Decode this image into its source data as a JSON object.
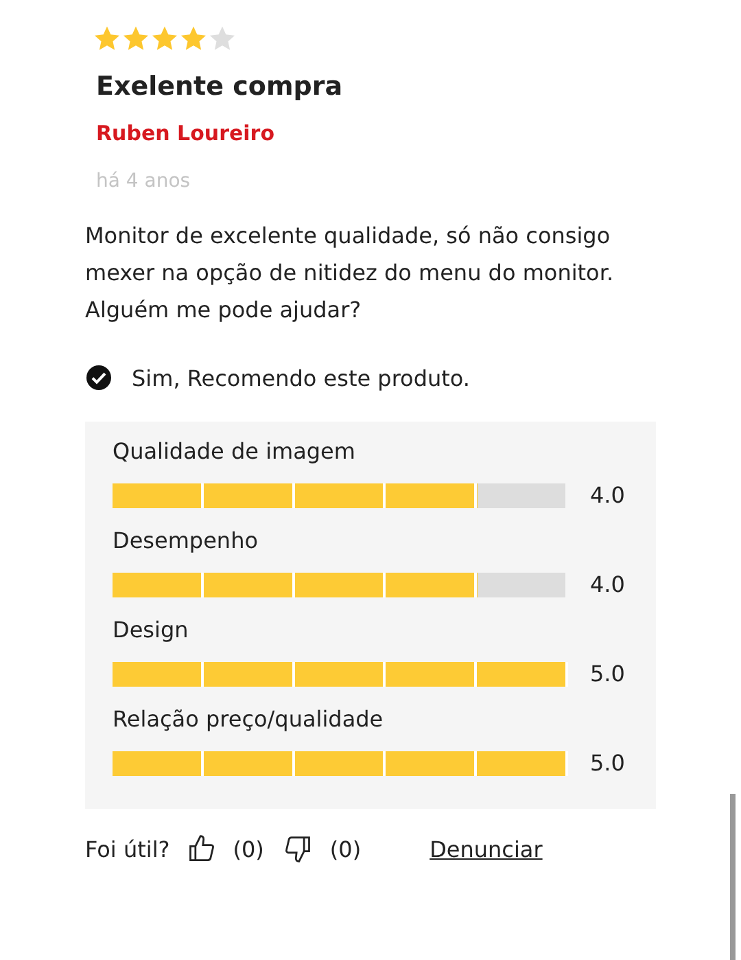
{
  "review": {
    "stars": 4,
    "title": "Exelente compra",
    "author": "Ruben Loureiro",
    "date": "há 4 anos",
    "body": "Monitor de excelente qualidade, só não consigo mexer na opção de nitidez do menu do monitor. Alguém me pode ajudar?",
    "recommend": {
      "checked": true,
      "label": "Sim, Recomendo este produto."
    }
  },
  "ratings": [
    {
      "label": "Qualidade de imagem",
      "level": 0.8,
      "value": "4.0"
    },
    {
      "label": "Desempenho",
      "level": 0.8,
      "value": "4.0"
    },
    {
      "label": "Design",
      "level": 1,
      "value": "5.0"
    },
    {
      "label": "Relação preço/qualidade",
      "level": 1,
      "value": "5.0"
    }
  ],
  "footer": {
    "question": "Foi útil?",
    "likes": "(0)",
    "dislikes": "(0)",
    "report": "Denunciar"
  }
}
